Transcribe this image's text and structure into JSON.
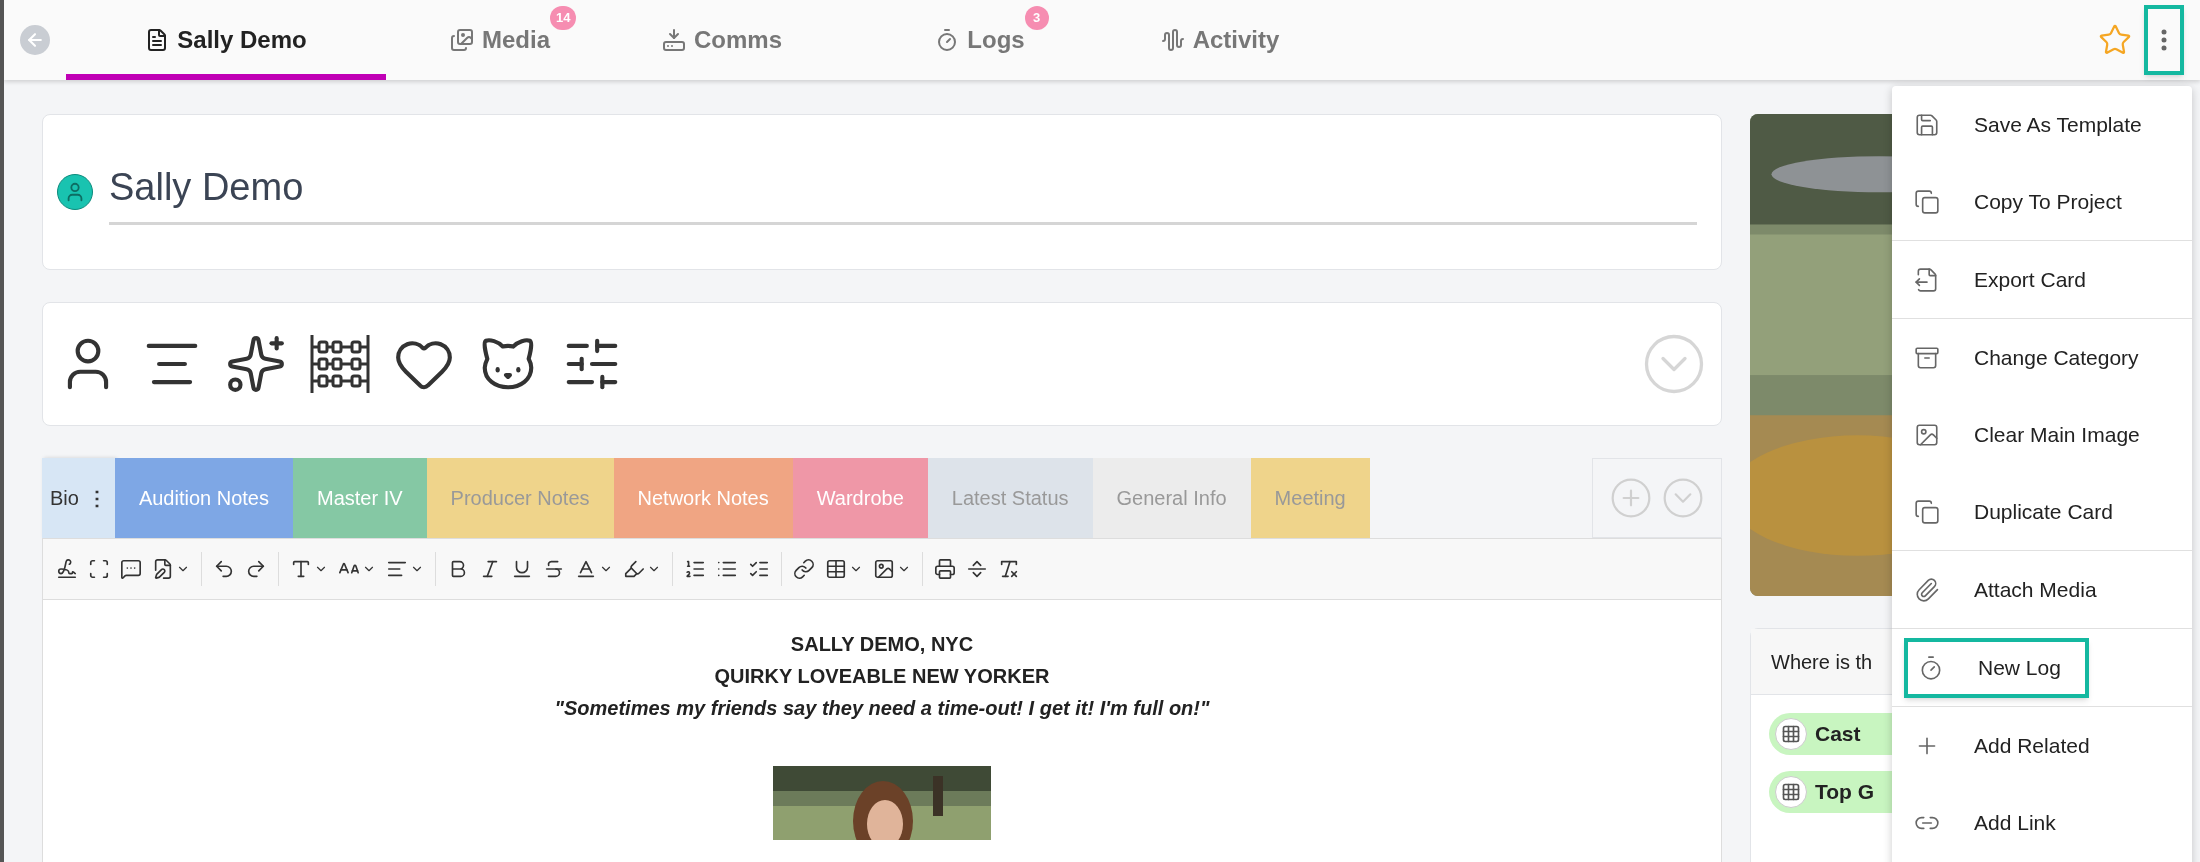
{
  "nav_tabs": [
    {
      "label": "Sally Demo",
      "selected": true
    },
    {
      "label": "Media",
      "selected": false,
      "badge": "14"
    },
    {
      "label": "Comms",
      "selected": false
    },
    {
      "label": "Logs",
      "selected": false,
      "badge": "3"
    },
    {
      "label": "Activity",
      "selected": false
    }
  ],
  "more_button": {
    "highlighted": true
  },
  "card_title": "Sally Demo",
  "note_tabs": [
    {
      "label": "Bio",
      "selected": true,
      "menu": "⋮",
      "color": "#d7e6f5"
    },
    {
      "label": "Audition Notes",
      "selected": false,
      "color": "#7ea7e5"
    },
    {
      "label": "Master IV",
      "selected": false,
      "color": "#85c8a4"
    },
    {
      "label": "Producer Notes",
      "selected": false,
      "color": "#efd48b"
    },
    {
      "label": "Network Notes",
      "selected": false,
      "color": "#f0a583"
    },
    {
      "label": "Wardrobe",
      "selected": false,
      "color": "#ef97a7"
    },
    {
      "label": "Latest Status",
      "selected": false,
      "color": "#dde3ea"
    },
    {
      "label": "General Info",
      "selected": false,
      "color": "#ececec"
    },
    {
      "label": "Meeting",
      "selected": false,
      "color": "#efd48b"
    }
  ],
  "document": {
    "lines": [
      {
        "text": "SALLY DEMO, NYC",
        "kind": "bold"
      },
      {
        "text": "QUIRKY LOVEABLE NEW YORKER",
        "kind": "bold"
      },
      {
        "text": "\"Sometimes my friends say they need a time-out! I get it! I'm full on!\"",
        "kind": "italic"
      }
    ]
  },
  "side_card": {
    "title": "Where is th",
    "chips": [
      "Cast",
      "Top G"
    ]
  },
  "menu": {
    "sections": [
      [
        {
          "label": "Save As Template",
          "highlighted": false
        },
        {
          "label": "Copy To Project",
          "highlighted": false
        }
      ],
      [
        {
          "label": "Export Card",
          "highlighted": false
        }
      ],
      [
        {
          "label": "Change Category",
          "highlighted": false
        },
        {
          "label": "Clear Main Image",
          "highlighted": false
        },
        {
          "label": "Duplicate Card",
          "highlighted": false
        }
      ],
      [
        {
          "label": "Attach Media",
          "highlighted": false
        }
      ],
      [
        {
          "label": "New Log",
          "highlighted": true
        }
      ],
      [
        {
          "label": "Add Related",
          "highlighted": false
        },
        {
          "label": "Add Link",
          "highlighted": false
        }
      ]
    ]
  }
}
